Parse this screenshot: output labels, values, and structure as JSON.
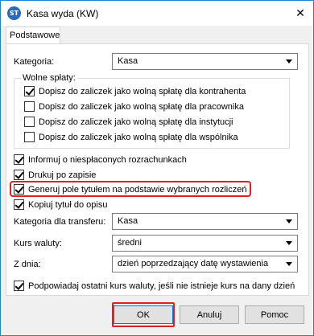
{
  "window": {
    "title": "Kasa wyda (KW)",
    "app_icon_text": "ST",
    "close_glyph": "✕"
  },
  "tabs": [
    {
      "label": "Podstawowe",
      "active": true
    }
  ],
  "fields": {
    "kategoria_label": "Kategoria:",
    "kategoria_value": "Kasa",
    "kategoria_transferu_label": "Kategoria dla transferu:",
    "kategoria_transferu_value": "Kasa",
    "kurs_waluty_label": "Kurs waluty:",
    "kurs_waluty_value": "średni",
    "z_dnia_label": "Z dnia:",
    "z_dnia_value": "dzień poprzedzający datę wystawienia"
  },
  "wolne_splaty": {
    "legend": "Wolne spłaty:",
    "items": [
      {
        "label": "Dopisz do zaliczek jako wolną spłatę dla kontrahenta",
        "checked": true
      },
      {
        "label": "Dopisz do zaliczek jako wolną spłatę dla pracownika",
        "checked": false
      },
      {
        "label": "Dopisz do zaliczek jako wolną spłatę dla instytucji",
        "checked": false
      },
      {
        "label": "Dopisz do zaliczek jako wolną spłatę dla wspólnika",
        "checked": false
      }
    ]
  },
  "options": [
    {
      "label": "Informuj o niespłaconych rozrachunkach",
      "checked": true
    },
    {
      "label": "Drukuj po zapisie",
      "checked": true
    },
    {
      "label": "Generuj pole tytułem na podstawie wybranych rozliczeń",
      "checked": true,
      "highlighted": true
    },
    {
      "label": "Kopiuj tytuł do opisu",
      "checked": true
    }
  ],
  "podpowiadaj": {
    "label": "Podpowiadaj ostatni kurs waluty, jeśli nie istnieje kurs na dany dzień",
    "checked": true
  },
  "buttons": {
    "ok": "OK",
    "cancel": "Anuluj",
    "help": "Pomoc"
  },
  "colors": {
    "highlight": "#e02020",
    "window_border": "#1883d7"
  }
}
